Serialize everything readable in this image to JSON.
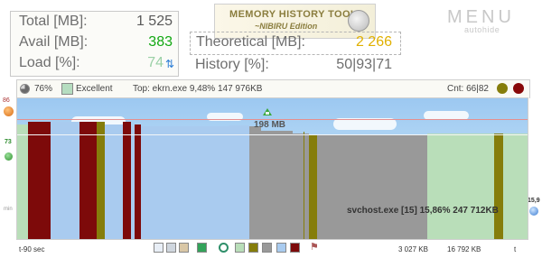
{
  "stats": {
    "total_label": "Total [MB]:",
    "total_value": "1 525",
    "avail_label": "Avail [MB]:",
    "avail_value": "383",
    "load_label": "Load [%]:",
    "load_value": "74"
  },
  "logo": {
    "title": "MEMORY HISTORY TOOL",
    "subtitle": "~NIBIRU Edition"
  },
  "theoretical": {
    "label": "Theoretical [MB]:",
    "value": "2 266"
  },
  "history": {
    "label": "History [%]:",
    "value": "50|93|71"
  },
  "menu": {
    "label": "MENU",
    "sublabel": "autohide"
  },
  "info_bar": {
    "percent": "76%",
    "quality": "Excellent",
    "top_process": "Top:  ekrn.exe   9,48%   147 976KB",
    "count": "Cnt: 66|82"
  },
  "chart": {
    "marker_label": "198 MB",
    "process_label": "svchost.exe [15]   15,86%   247 712KB",
    "axis_max": "86",
    "axis_avail": "73",
    "axis_min": "min",
    "right_value": "15,9"
  },
  "bottom_bar": {
    "time": "t-90 sec",
    "kb_a": "3 027 KB",
    "kb_b": "16 792 KB",
    "t": "t"
  },
  "colors": {
    "red": "#7d0a0a",
    "olive": "#857d0b",
    "gray": "#999999",
    "blue": "#a9cbef",
    "green": "#b9deb9",
    "sky": "#9cc8f1"
  },
  "chart_data": {
    "type": "bar",
    "legend": [
      "red",
      "olive",
      "gray",
      "blue",
      "green"
    ],
    "max_line_mb": 198
  }
}
